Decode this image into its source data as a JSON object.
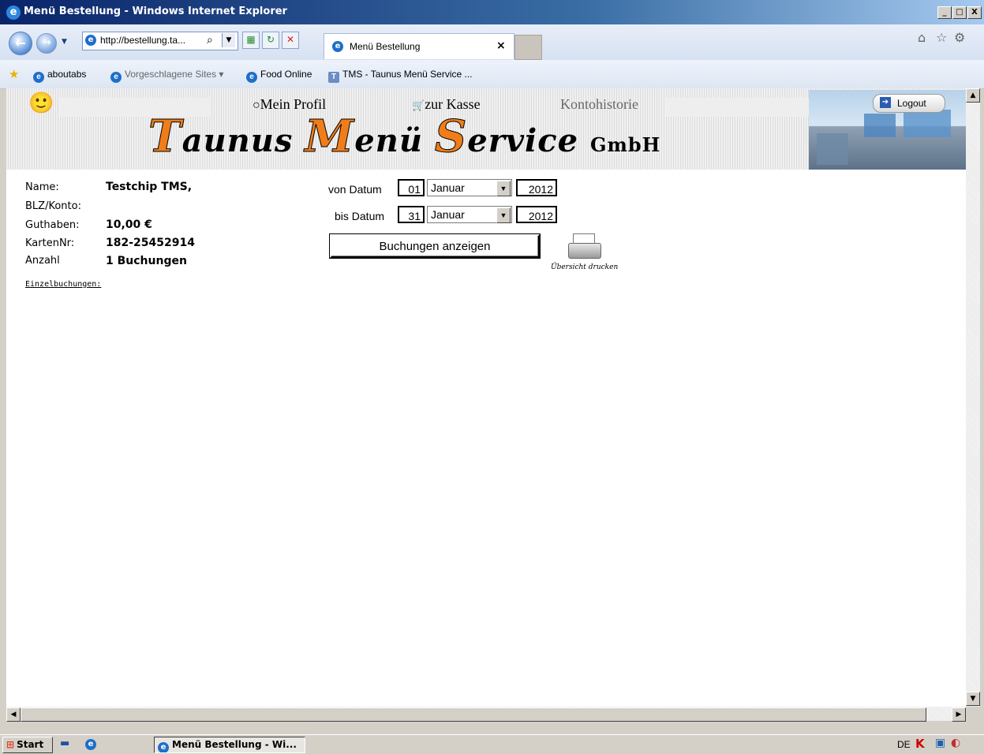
{
  "window": {
    "title": "Menü Bestellung - Windows Internet Explorer",
    "min": "_",
    "max": "□",
    "close": "X"
  },
  "browser": {
    "back": "←",
    "forward": "→",
    "address": "http://bestellung.ta...",
    "tab_title": "Menü Bestellung",
    "tab_close": "×"
  },
  "favorites": {
    "items": [
      "aboutabs",
      "Vorgeschlagene Sites ▾",
      "Food Online",
      "TMS - Taunus Menü Service ..."
    ]
  },
  "site": {
    "menu": {
      "profile": "Mein Profil",
      "checkout": "zur Kasse",
      "history": "Kontohistorie"
    },
    "logo": {
      "t1": "T",
      "w1": "aunus ",
      "t2": "M",
      "w2": "enü ",
      "t3": "S",
      "w3": "ervice ",
      "suffix": "GmbH"
    },
    "logout": "Logout"
  },
  "account": {
    "name_label": "Name:",
    "name_value": "Testchip TMS,",
    "blz_label": "BLZ/Konto:",
    "balance_label": "Guthaben:",
    "balance_value": "10,00 €",
    "card_label": "KartenNr:",
    "card_value": "182-25452914",
    "count_label": "Anzahl",
    "count_value": "1 Buchungen",
    "details_link": "Einzelbuchungen:"
  },
  "filter": {
    "from_label": "von Datum",
    "from_day": "01",
    "from_month": "Januar",
    "from_year": "2012",
    "to_label": "bis Datum",
    "to_day": "31",
    "to_month": "Januar",
    "to_year": "2012",
    "show_button": "Buchungen anzeigen",
    "print_label": "Übersicht drucken"
  },
  "taskbar": {
    "start": "Start",
    "item": "Menü Bestellung - Wi...",
    "lang": "DE"
  }
}
